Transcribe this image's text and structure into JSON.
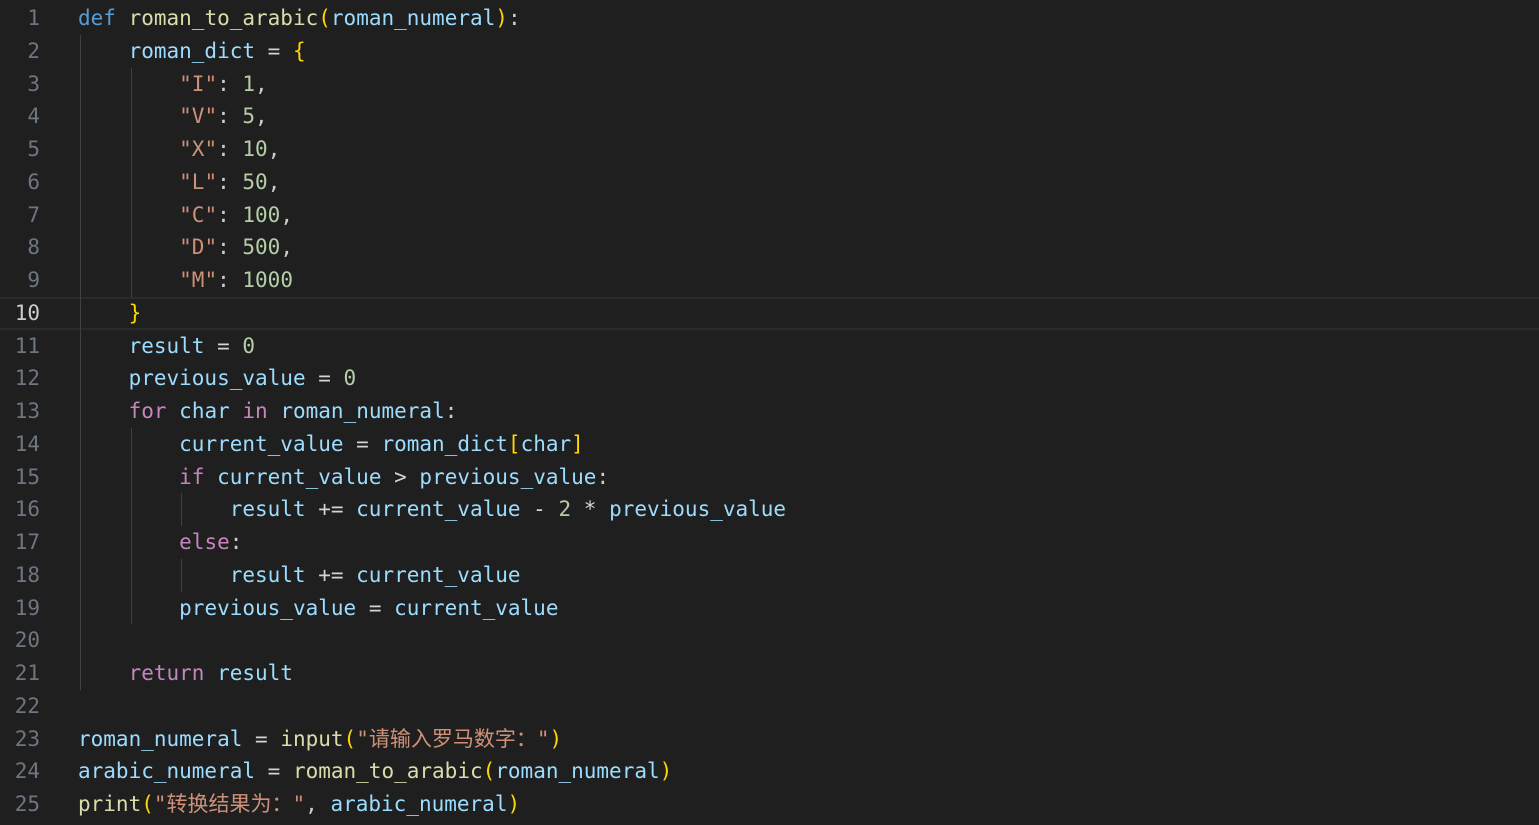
{
  "editor": {
    "language": "python",
    "current_line": 10,
    "colors": {
      "background": "#1f1f1f",
      "keyword": "#569cd6",
      "control": "#c586c0",
      "function": "#dcdcaa",
      "variable": "#9cdcfe",
      "string": "#ce9178",
      "number": "#b5cea8"
    },
    "lines": [
      {
        "n": "1",
        "tokens": [
          [
            "kw-def",
            "def"
          ],
          [
            "op",
            " "
          ],
          [
            "fn",
            "roman_to_arabic"
          ],
          [
            "b1",
            "("
          ],
          [
            "var",
            "roman_numeral"
          ],
          [
            "b1",
            ")"
          ],
          [
            "punc",
            ":"
          ]
        ]
      },
      {
        "n": "2",
        "tokens": [
          [
            "op",
            "    "
          ],
          [
            "var",
            "roman_dict"
          ],
          [
            "op",
            " = "
          ],
          [
            "b1",
            "{"
          ]
        ]
      },
      {
        "n": "3",
        "tokens": [
          [
            "op",
            "        "
          ],
          [
            "str",
            "\"I\""
          ],
          [
            "punc",
            ": "
          ],
          [
            "num",
            "1"
          ],
          [
            "punc",
            ","
          ]
        ]
      },
      {
        "n": "4",
        "tokens": [
          [
            "op",
            "        "
          ],
          [
            "str",
            "\"V\""
          ],
          [
            "punc",
            ": "
          ],
          [
            "num",
            "5"
          ],
          [
            "punc",
            ","
          ]
        ]
      },
      {
        "n": "5",
        "tokens": [
          [
            "op",
            "        "
          ],
          [
            "str",
            "\"X\""
          ],
          [
            "punc",
            ": "
          ],
          [
            "num",
            "10"
          ],
          [
            "punc",
            ","
          ]
        ]
      },
      {
        "n": "6",
        "tokens": [
          [
            "op",
            "        "
          ],
          [
            "str",
            "\"L\""
          ],
          [
            "punc",
            ": "
          ],
          [
            "num",
            "50"
          ],
          [
            "punc",
            ","
          ]
        ]
      },
      {
        "n": "7",
        "tokens": [
          [
            "op",
            "        "
          ],
          [
            "str",
            "\"C\""
          ],
          [
            "punc",
            ": "
          ],
          [
            "num",
            "100"
          ],
          [
            "punc",
            ","
          ]
        ]
      },
      {
        "n": "8",
        "tokens": [
          [
            "op",
            "        "
          ],
          [
            "str",
            "\"D\""
          ],
          [
            "punc",
            ": "
          ],
          [
            "num",
            "500"
          ],
          [
            "punc",
            ","
          ]
        ]
      },
      {
        "n": "9",
        "tokens": [
          [
            "op",
            "        "
          ],
          [
            "str",
            "\"M\""
          ],
          [
            "punc",
            ": "
          ],
          [
            "num",
            "1000"
          ]
        ]
      },
      {
        "n": "10",
        "tokens": [
          [
            "op",
            "    "
          ],
          [
            "b1",
            "}"
          ]
        ]
      },
      {
        "n": "11",
        "tokens": [
          [
            "op",
            "    "
          ],
          [
            "var",
            "result"
          ],
          [
            "op",
            " = "
          ],
          [
            "num",
            "0"
          ]
        ]
      },
      {
        "n": "12",
        "tokens": [
          [
            "op",
            "    "
          ],
          [
            "var",
            "previous_value"
          ],
          [
            "op",
            " = "
          ],
          [
            "num",
            "0"
          ]
        ]
      },
      {
        "n": "13",
        "tokens": [
          [
            "op",
            "    "
          ],
          [
            "kw-ctrl",
            "for"
          ],
          [
            "op",
            " "
          ],
          [
            "var",
            "char"
          ],
          [
            "op",
            " "
          ],
          [
            "kw-ctrl",
            "in"
          ],
          [
            "op",
            " "
          ],
          [
            "var",
            "roman_numeral"
          ],
          [
            "punc",
            ":"
          ]
        ]
      },
      {
        "n": "14",
        "tokens": [
          [
            "op",
            "        "
          ],
          [
            "var",
            "current_value"
          ],
          [
            "op",
            " = "
          ],
          [
            "var",
            "roman_dict"
          ],
          [
            "b1",
            "["
          ],
          [
            "var",
            "char"
          ],
          [
            "b1",
            "]"
          ]
        ]
      },
      {
        "n": "15",
        "tokens": [
          [
            "op",
            "        "
          ],
          [
            "kw-ctrl",
            "if"
          ],
          [
            "op",
            " "
          ],
          [
            "var",
            "current_value"
          ],
          [
            "op",
            " > "
          ],
          [
            "var",
            "previous_value"
          ],
          [
            "punc",
            ":"
          ]
        ]
      },
      {
        "n": "16",
        "tokens": [
          [
            "op",
            "            "
          ],
          [
            "var",
            "result"
          ],
          [
            "op",
            " += "
          ],
          [
            "var",
            "current_value"
          ],
          [
            "op",
            " - "
          ],
          [
            "num",
            "2"
          ],
          [
            "op",
            " * "
          ],
          [
            "var",
            "previous_value"
          ]
        ]
      },
      {
        "n": "17",
        "tokens": [
          [
            "op",
            "        "
          ],
          [
            "kw-ctrl",
            "else"
          ],
          [
            "punc",
            ":"
          ]
        ]
      },
      {
        "n": "18",
        "tokens": [
          [
            "op",
            "            "
          ],
          [
            "var",
            "result"
          ],
          [
            "op",
            " += "
          ],
          [
            "var",
            "current_value"
          ]
        ]
      },
      {
        "n": "19",
        "tokens": [
          [
            "op",
            "        "
          ],
          [
            "var",
            "previous_value"
          ],
          [
            "op",
            " = "
          ],
          [
            "var",
            "current_value"
          ]
        ]
      },
      {
        "n": "20",
        "tokens": []
      },
      {
        "n": "21",
        "tokens": [
          [
            "op",
            "    "
          ],
          [
            "kw-ctrl",
            "return"
          ],
          [
            "op",
            " "
          ],
          [
            "var",
            "result"
          ]
        ]
      },
      {
        "n": "22",
        "tokens": []
      },
      {
        "n": "23",
        "tokens": [
          [
            "var",
            "roman_numeral"
          ],
          [
            "op",
            " = "
          ],
          [
            "fn",
            "input"
          ],
          [
            "b1",
            "("
          ],
          [
            "str",
            "\"请输入罗马数字：\""
          ],
          [
            "b1",
            ")"
          ]
        ]
      },
      {
        "n": "24",
        "tokens": [
          [
            "var",
            "arabic_numeral"
          ],
          [
            "op",
            " = "
          ],
          [
            "fn",
            "roman_to_arabic"
          ],
          [
            "b1",
            "("
          ],
          [
            "var",
            "roman_numeral"
          ],
          [
            "b1",
            ")"
          ]
        ]
      },
      {
        "n": "25",
        "tokens": [
          [
            "fn",
            "print"
          ],
          [
            "b1",
            "("
          ],
          [
            "str",
            "\"转换结果为：\""
          ],
          [
            "punc",
            ", "
          ],
          [
            "var",
            "arabic_numeral"
          ],
          [
            "b1",
            ")"
          ]
        ]
      }
    ]
  }
}
